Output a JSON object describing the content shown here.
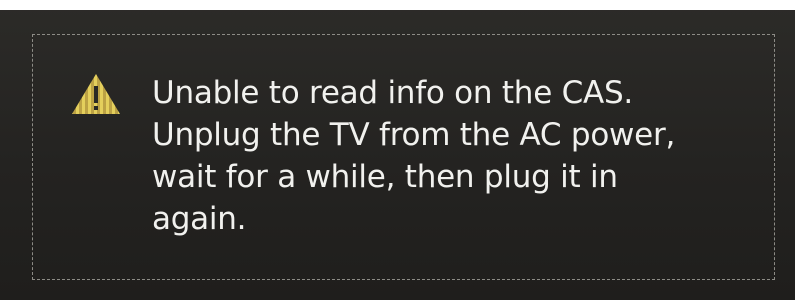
{
  "dialog": {
    "icon": "warning-icon",
    "message": "Unable to read info on the CAS.\nUnplug the TV from the AC power,\nwait for a while, then plug it in\nagain."
  },
  "colors": {
    "background": "#262522",
    "text": "#f1f1ee",
    "warning": "#e4cf5c",
    "frame": "#8d8c86"
  }
}
